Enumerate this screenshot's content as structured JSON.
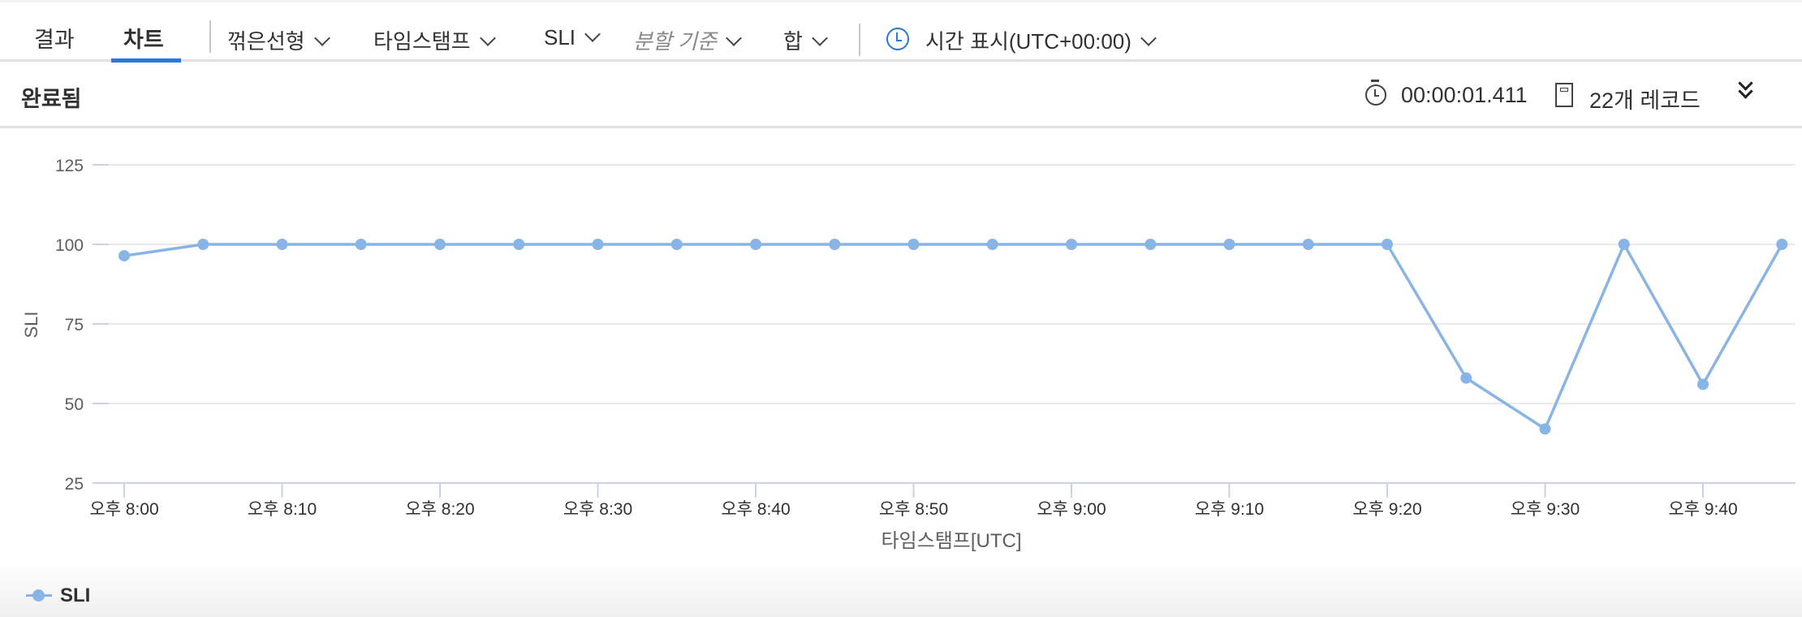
{
  "tabs": [
    {
      "label": "결과",
      "active": false
    },
    {
      "label": "차트",
      "active": true
    }
  ],
  "toolbar": {
    "chart_type": "꺾은선형",
    "x_column": "타임스탬프",
    "y_column": "SLI",
    "split_by_placeholder": "분할 기준",
    "aggregation": "합",
    "time_display": "시간 표시(UTC+00:00)",
    "accent_color": "#2b79d0"
  },
  "status": {
    "title": "완료됨",
    "elapsed": "00:00:01.411",
    "records": "22개 레코드"
  },
  "chart_data": {
    "type": "line",
    "title": "",
    "xlabel": "타임스탬프[UTC]",
    "ylabel": "SLI",
    "ylim": [
      25,
      125
    ],
    "yticks": [
      125,
      100,
      75,
      50,
      25
    ],
    "x_tick_labels": [
      "오후 8:00",
      "오후 8:10",
      "오후 8:20",
      "오후 8:30",
      "오후 8:40",
      "오후 8:50",
      "오후 9:00",
      "오후 9:10",
      "오후 9:20",
      "오후 9:30",
      "오후 9:40"
    ],
    "grid": true,
    "legend_position": "bottom-left",
    "series": [
      {
        "name": "SLI",
        "color": "#89b4e6",
        "x_minutes_after_8pm": [
          0,
          5,
          10,
          15,
          20,
          25,
          30,
          35,
          40,
          45,
          50,
          55,
          60,
          65,
          70,
          75,
          80,
          85,
          90,
          95,
          100,
          105
        ],
        "x": [
          "오후 8:00",
          "오후 8:05",
          "오후 8:10",
          "오후 8:15",
          "오후 8:20",
          "오후 8:25",
          "오후 8:30",
          "오후 8:35",
          "오후 8:40",
          "오후 8:45",
          "오후 8:50",
          "오후 8:55",
          "오후 9:00",
          "오후 9:05",
          "오후 9:10",
          "오후 9:15",
          "오후 9:20",
          "오후 9:25",
          "오후 9:30",
          "오후 9:35",
          "오후 9:40",
          "오후 9:45"
        ],
        "values": [
          96.4,
          100,
          100,
          100,
          100,
          100,
          100,
          100,
          100,
          100,
          100,
          100,
          100,
          100,
          100,
          100,
          100,
          58,
          42,
          100,
          56,
          100
        ]
      }
    ]
  }
}
